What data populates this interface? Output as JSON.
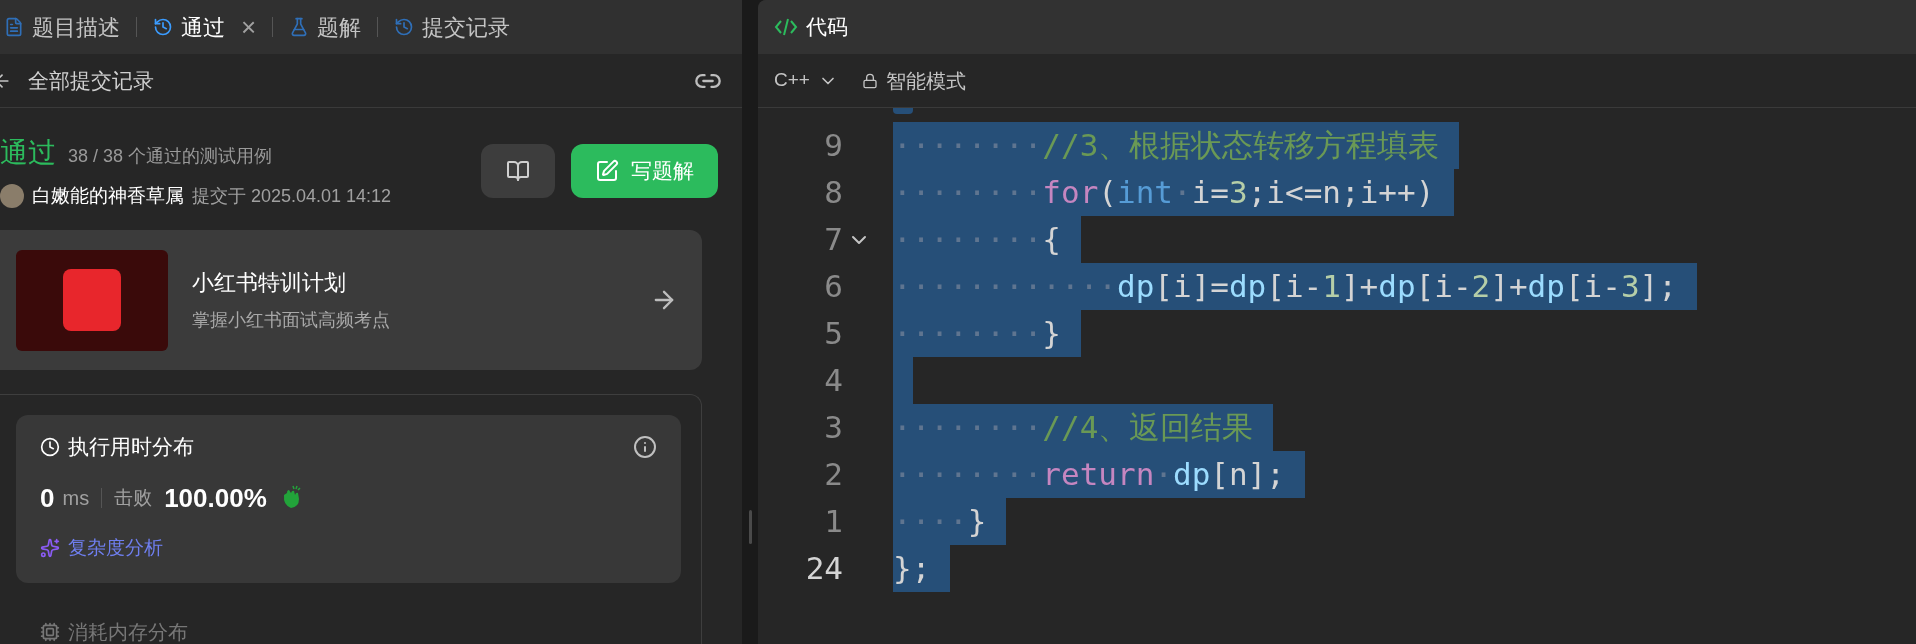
{
  "tabs": [
    {
      "label": "题目描述",
      "selected": false,
      "closable": false
    },
    {
      "label": "通过",
      "selected": true,
      "closable": true
    },
    {
      "label": "题解",
      "selected": false,
      "closable": false
    },
    {
      "label": "提交记录",
      "selected": false,
      "closable": false
    }
  ],
  "close_glyph": "×",
  "header": {
    "title": "全部提交记录"
  },
  "submission": {
    "status": "通过",
    "cases": "38 / 38 个通过的测试用例",
    "user": "白嫩能的神香草属",
    "submitted": "提交于 2025.04.01 14:12",
    "write_button": "写题解"
  },
  "promo": {
    "title": "小红书特训计划",
    "subtitle": "掌握小红书面试高频考点"
  },
  "runtime": {
    "title": "执行用时分布",
    "value": "0",
    "unit": "ms",
    "beats_label": "击败",
    "percent": "100.00%",
    "analysis": "复杂度分析"
  },
  "memory": {
    "title": "消耗内存分布"
  },
  "editor": {
    "title": "代码",
    "language": "C++",
    "mode": "智能模式",
    "lines": [
      {
        "number": "9",
        "selected": true,
        "foldable": false,
        "tokens": [
          {
            "kind": "space",
            "text": "········"
          },
          {
            "kind": "comment",
            "text": "//3、根据状态转移方程填表"
          }
        ]
      },
      {
        "number": "8",
        "selected": true,
        "foldable": false,
        "tokens": [
          {
            "kind": "space",
            "text": "········"
          },
          {
            "kind": "keyword",
            "text": "for"
          },
          {
            "kind": "plain",
            "text": "("
          },
          {
            "kind": "type",
            "text": "int"
          },
          {
            "kind": "space",
            "text": "·"
          },
          {
            "kind": "plain",
            "text": "i="
          },
          {
            "kind": "number",
            "text": "3"
          },
          {
            "kind": "plain",
            "text": ";i<=n;i++)"
          }
        ]
      },
      {
        "number": "7",
        "selected": true,
        "foldable": true,
        "tokens": [
          {
            "kind": "space",
            "text": "········"
          },
          {
            "kind": "plain",
            "text": "{"
          }
        ]
      },
      {
        "number": "6",
        "selected": true,
        "foldable": false,
        "tokens": [
          {
            "kind": "space",
            "text": "············"
          },
          {
            "kind": "ident",
            "text": "dp"
          },
          {
            "kind": "plain",
            "text": "[i]="
          },
          {
            "kind": "ident",
            "text": "dp"
          },
          {
            "kind": "plain",
            "text": "[i-"
          },
          {
            "kind": "number",
            "text": "1"
          },
          {
            "kind": "plain",
            "text": "]+"
          },
          {
            "kind": "ident",
            "text": "dp"
          },
          {
            "kind": "plain",
            "text": "[i-"
          },
          {
            "kind": "number",
            "text": "2"
          },
          {
            "kind": "plain",
            "text": "]+"
          },
          {
            "kind": "ident",
            "text": "dp"
          },
          {
            "kind": "plain",
            "text": "[i-"
          },
          {
            "kind": "number",
            "text": "3"
          },
          {
            "kind": "plain",
            "text": "];"
          }
        ]
      },
      {
        "number": "5",
        "selected": true,
        "foldable": false,
        "tokens": [
          {
            "kind": "space",
            "text": "········"
          },
          {
            "kind": "plain",
            "text": "}"
          }
        ]
      },
      {
        "number": "4",
        "selected": true,
        "foldable": false
      },
      {
        "number": "3",
        "selected": true,
        "foldable": false,
        "tokens": [
          {
            "kind": "space",
            "text": "········"
          },
          {
            "kind": "comment",
            "text": "//4、返回结果"
          }
        ]
      },
      {
        "number": "2",
        "selected": true,
        "foldable": false,
        "tokens": [
          {
            "kind": "space",
            "text": "········"
          },
          {
            "kind": "keyword",
            "text": "return"
          },
          {
            "kind": "space",
            "text": "·"
          },
          {
            "kind": "ident",
            "text": "dp"
          },
          {
            "kind": "plain",
            "text": "[n];"
          }
        ]
      },
      {
        "number": "1",
        "selected": true,
        "foldable": false,
        "tokens": [
          {
            "kind": "space",
            "text": "····"
          },
          {
            "kind": "plain",
            "text": "}"
          }
        ]
      },
      {
        "number": "24",
        "selected": true,
        "foldable": false,
        "tokens": [
          {
            "kind": "plain",
            "text": "};"
          }
        ]
      }
    ]
  }
}
